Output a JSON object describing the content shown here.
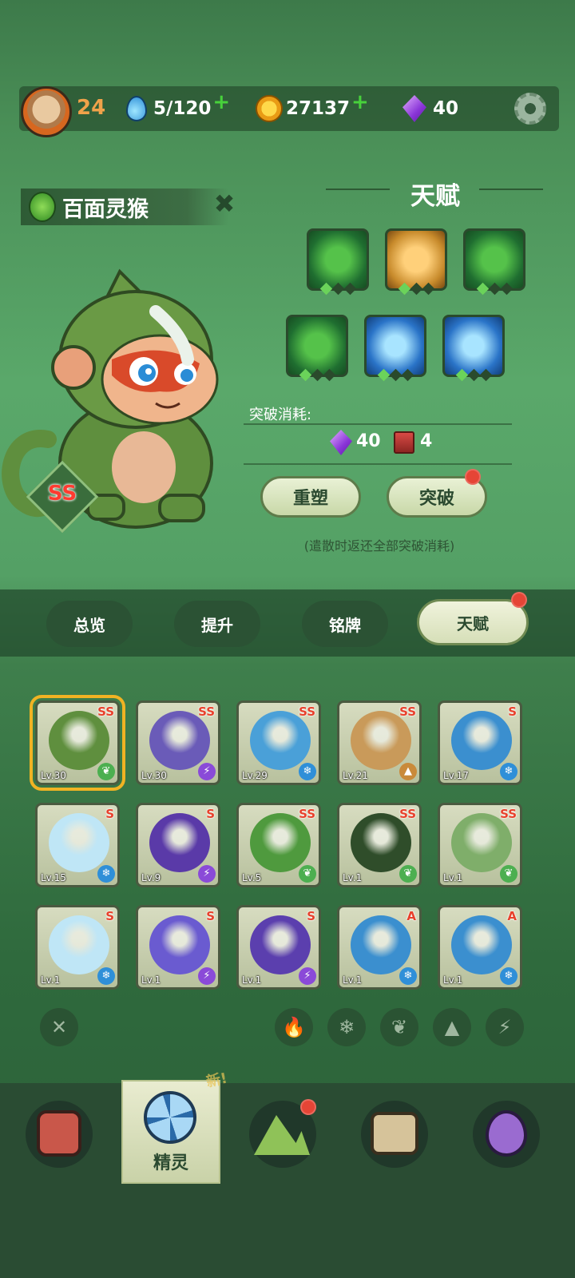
{
  "topbar": {
    "level": "24",
    "stamina": "5/120",
    "coins": "27137",
    "gems": "40",
    "icons": [
      "avatar-icon",
      "water-drop-icon",
      "coin-icon",
      "gem-icon",
      "gear-icon"
    ]
  },
  "pet": {
    "name": "百面灵猴",
    "rank": "SS"
  },
  "talent": {
    "title": "天赋",
    "slots": [
      {
        "icon": "claw-icon",
        "color": "green",
        "level": 1
      },
      {
        "icon": "wave-icon",
        "color": "gold",
        "level": 1
      },
      {
        "icon": "spike-icon",
        "color": "green",
        "level": 1
      },
      {
        "icon": "spike-icon",
        "color": "green",
        "level": 1
      },
      {
        "icon": "eye-icon",
        "color": "blue",
        "level": 1
      },
      {
        "icon": "gear-ring-icon",
        "color": "blue",
        "level": 1
      }
    ],
    "break_label": "突破消耗:",
    "cost_gems": "40",
    "cost_books": "4",
    "reshape_label": "重塑",
    "breakthrough_label": "突破",
    "note": "(遣散时返还全部突破消耗)"
  },
  "tabs": [
    "总览",
    "提升",
    "铭牌",
    "天赋"
  ],
  "pets": [
    {
      "lv": "Lv.30",
      "rank": "SS",
      "element": "grass",
      "color": "#5f8f3e"
    },
    {
      "lv": "Lv.30",
      "rank": "SS",
      "element": "electric",
      "color": "#6a5bb8"
    },
    {
      "lv": "Lv.29",
      "rank": "SS",
      "element": "ice",
      "color": "#4aa0d8"
    },
    {
      "lv": "Lv.21",
      "rank": "SS",
      "element": "rock",
      "color": "#c99a5a"
    },
    {
      "lv": "Lv.17",
      "rank": "S",
      "element": "ice",
      "color": "#3b8fcf"
    },
    {
      "lv": "Lv.15",
      "rank": "S",
      "element": "ice",
      "color": "#bfe6f6"
    },
    {
      "lv": "Lv.9",
      "rank": "S",
      "element": "electric",
      "color": "#5a3aa8"
    },
    {
      "lv": "Lv.5",
      "rank": "SS",
      "element": "grass",
      "color": "#4f9a3e"
    },
    {
      "lv": "Lv.1",
      "rank": "SS",
      "element": "grass",
      "color": "#2f4d2a"
    },
    {
      "lv": "Lv.1",
      "rank": "SS",
      "element": "grass",
      "color": "#7fae6a"
    },
    {
      "lv": "Lv.1",
      "rank": "S",
      "element": "ice",
      "color": "#bfe6f6"
    },
    {
      "lv": "Lv.1",
      "rank": "S",
      "element": "electric",
      "color": "#6a5bd0"
    },
    {
      "lv": "Lv.1",
      "rank": "S",
      "element": "electric",
      "color": "#5b3fae"
    },
    {
      "lv": "Lv.1",
      "rank": "A",
      "element": "ice",
      "color": "#3b8fcf"
    },
    {
      "lv": "Lv.1",
      "rank": "A",
      "element": "ice",
      "color": "#3b8fcf"
    }
  ],
  "filters": [
    "clear-filter-icon",
    "fire-icon",
    "ice-icon",
    "grass-icon",
    "rock-icon",
    "electric-icon"
  ],
  "nav": {
    "active_label": "精灵",
    "new_tag": "新!",
    "items": [
      "backpack-icon",
      "spirit-icon",
      "mountain-icon",
      "chest-icon",
      "map-pin-icon"
    ]
  },
  "colors": {
    "accent_gold": "#f0b323",
    "rank_red": "#e8402b",
    "plus_green": "#47d23b"
  }
}
